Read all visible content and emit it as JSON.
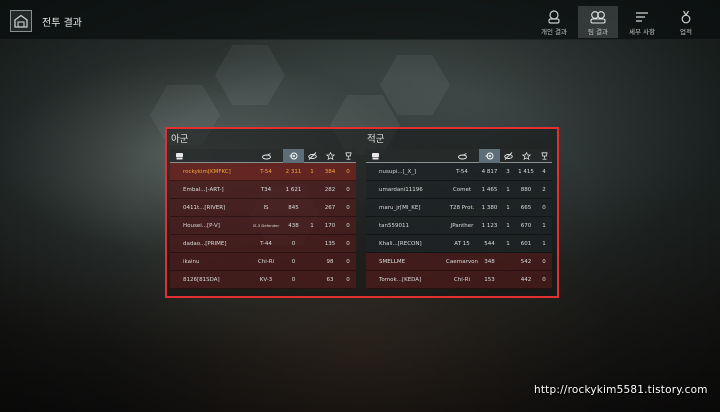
{
  "header": {
    "title": "전투 결과",
    "tabs": [
      {
        "label": "개인 결과",
        "icon": "single-tank-icon",
        "active": false
      },
      {
        "label": "팀 결과",
        "icon": "team-tanks-icon",
        "active": true
      },
      {
        "label": "세부 사항",
        "icon": "list-lines-icon",
        "active": false
      },
      {
        "label": "업적",
        "icon": "medal-icon",
        "active": false
      }
    ]
  },
  "columns": [
    "tank-class-icon",
    "tank-icon",
    "damage-icon",
    "kills-icon",
    "star-icon",
    "trophy-icon"
  ],
  "allies": {
    "title": "아군",
    "players": [
      {
        "name": "rockykim[KMFKC]",
        "tank": "T-54",
        "damage": "2 311",
        "kills": "1",
        "xp": "384",
        "trophy": "0",
        "me": true
      },
      {
        "name": "Embal...[-ART-]",
        "tank": "T34",
        "damage": "1 621",
        "kills": "",
        "xp": "282",
        "trophy": "0"
      },
      {
        "name": "0411t...[RIVER]",
        "tank": "IS",
        "damage": "845",
        "kills": "",
        "xp": "267",
        "trophy": "0"
      },
      {
        "name": "Housei...[P-V]",
        "tank": "IS-3 Defender",
        "damage": "438",
        "kills": "1",
        "xp": "170",
        "trophy": "0"
      },
      {
        "name": "dadao...[PRIME]",
        "tank": "T-44",
        "damage": "0",
        "kills": "",
        "xp": "135",
        "trophy": "0"
      },
      {
        "name": "ikainu",
        "tank": "Chi-Ri",
        "damage": "0",
        "kills": "",
        "xp": "98",
        "trophy": "0"
      },
      {
        "name": "8126[81SDA]",
        "tank": "KV-3",
        "damage": "0",
        "kills": "",
        "xp": "63",
        "trophy": "0"
      }
    ]
  },
  "enemies": {
    "title": "적군",
    "players": [
      {
        "name": "nusupi...[_X_]",
        "tank": "T-54",
        "damage": "4 817",
        "kills": "3",
        "xp": "1 415",
        "trophy": "4",
        "dead": false
      },
      {
        "name": "umardani11196",
        "tank": "Comet",
        "damage": "1 465",
        "kills": "1",
        "xp": "880",
        "trophy": "2",
        "dead": false
      },
      {
        "name": "maru_jr[MI_KE]",
        "tank": "T28 Prot.",
        "damage": "1 380",
        "kills": "1",
        "xp": "665",
        "trophy": "0",
        "dead": false
      },
      {
        "name": "tan559011",
        "tank": "JPanther",
        "damage": "1 123",
        "kills": "1",
        "xp": "670",
        "trophy": "1",
        "dead": false
      },
      {
        "name": "Khali...[RECON]",
        "tank": "AT 15",
        "damage": "544",
        "kills": "1",
        "xp": "601",
        "trophy": "1",
        "dead": false
      },
      {
        "name": "SMELLME",
        "tank": "Caernarvon",
        "damage": "348",
        "kills": "",
        "xp": "542",
        "trophy": "0",
        "dead": true
      },
      {
        "name": "Tomok...[KEDA]",
        "tank": "Chi-Ri",
        "damage": "153",
        "kills": "",
        "xp": "442",
        "trophy": "0",
        "dead": true
      }
    ]
  },
  "watermark": "http://rockykim5581.tistory.com",
  "colors": {
    "frame_highlight": "#e03030",
    "ally_row": "#5f1c1c",
    "self_name": "#f0a840",
    "sorted_column": "#5d6e78"
  }
}
